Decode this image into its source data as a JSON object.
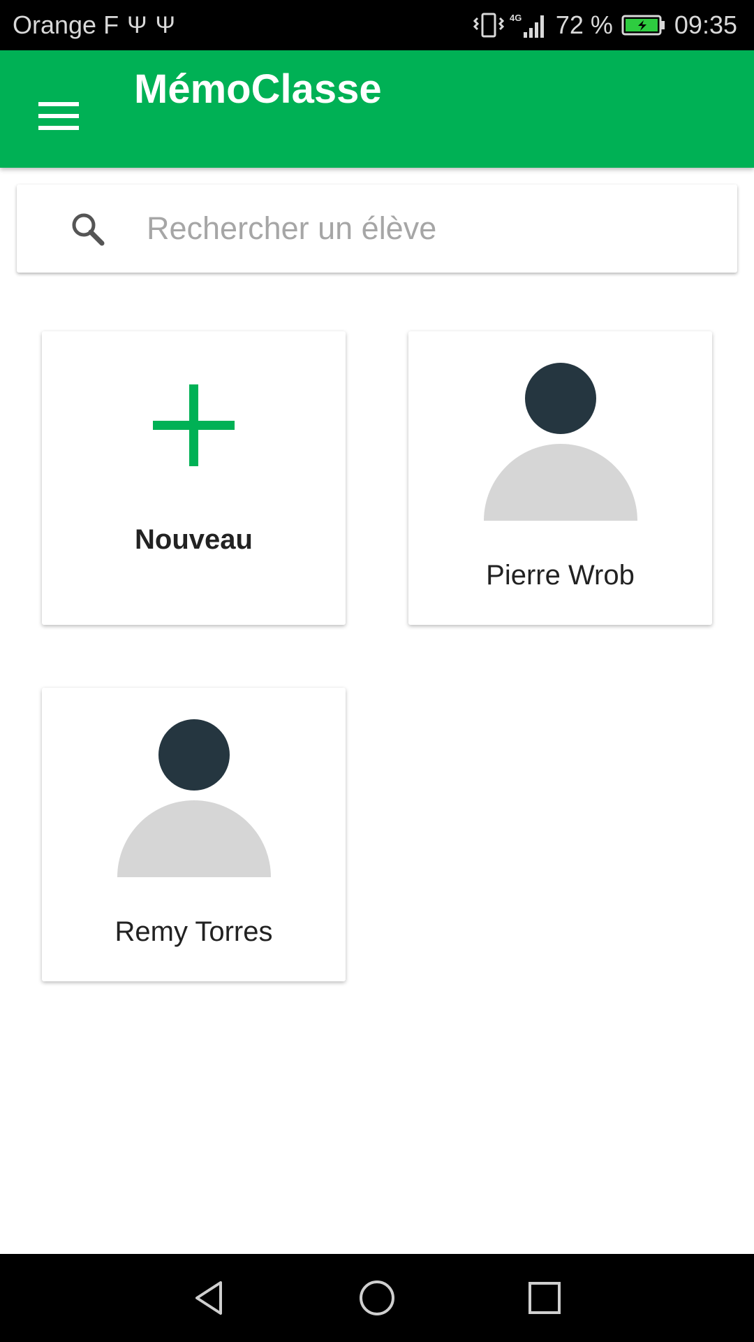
{
  "status_bar": {
    "carrier": "Orange F",
    "battery_percent": "72 %",
    "time": "09:35",
    "network": "4G",
    "icons": [
      "usb-icon",
      "usb-icon",
      "vibrate-icon",
      "signal-icon",
      "battery-charging-icon"
    ]
  },
  "app_bar": {
    "title": "MémoClasse",
    "menu_icon": "hamburger-menu-icon",
    "color": "#00b155"
  },
  "search": {
    "placeholder": "Rechercher un élève",
    "value": "",
    "icon": "search-icon"
  },
  "cards": {
    "new": {
      "label": "Nouveau",
      "icon": "plus-icon"
    },
    "students": [
      {
        "name": "Pierre Wrob",
        "icon": "avatar-icon"
      },
      {
        "name": "Remy Torres",
        "icon": "avatar-icon"
      }
    ]
  },
  "nav_bar": {
    "buttons": [
      "back-icon",
      "home-icon",
      "recents-icon"
    ]
  }
}
